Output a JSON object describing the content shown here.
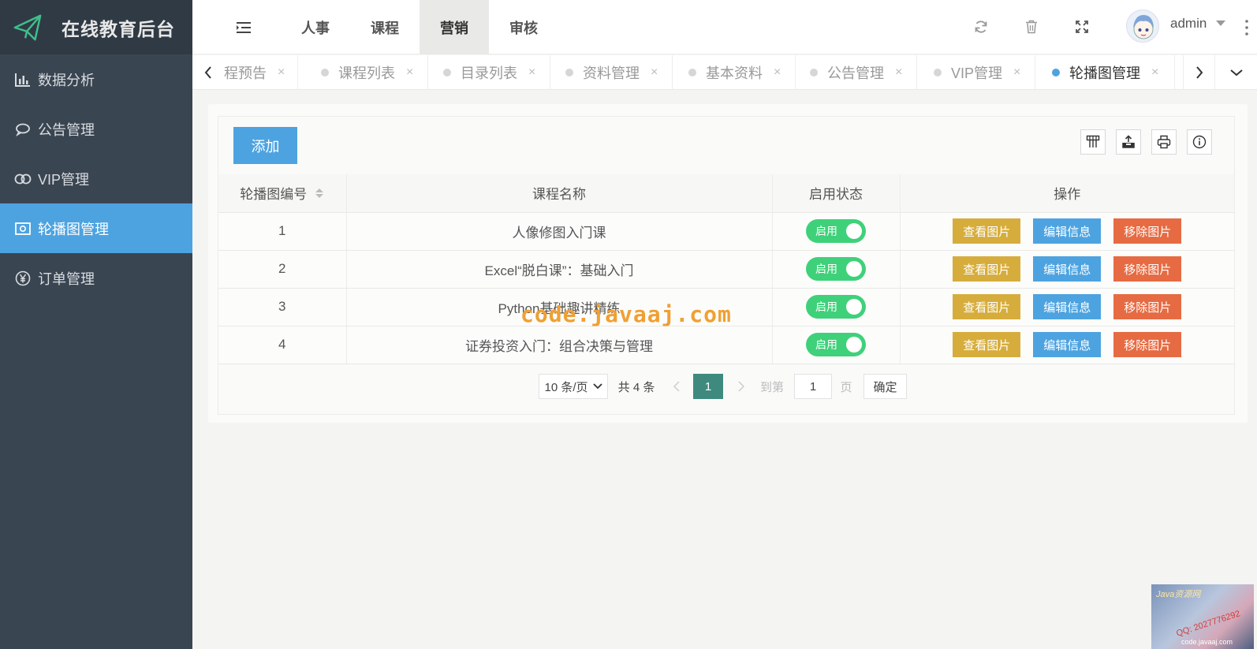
{
  "brand": {
    "title": "在线教育后台"
  },
  "sidebar": {
    "items": [
      {
        "label": "数据分析",
        "icon": "bar-chart-icon",
        "active": false
      },
      {
        "label": "公告管理",
        "icon": "chat-bubble-icon",
        "active": false
      },
      {
        "label": "VIP管理",
        "icon": "vip-icon",
        "active": false
      },
      {
        "label": "轮播图管理",
        "icon": "image-frame-icon",
        "active": true
      },
      {
        "label": "订单管理",
        "icon": "yen-icon",
        "active": false
      }
    ]
  },
  "topnav": {
    "tabs": [
      {
        "label": "人事"
      },
      {
        "label": "课程"
      },
      {
        "label": "营销",
        "active": true
      },
      {
        "label": "审核"
      }
    ],
    "user": "admin"
  },
  "pagetabs": [
    {
      "label": "程预告",
      "close": "×"
    },
    {
      "label": "课程列表",
      "close": "×"
    },
    {
      "label": "目录列表",
      "close": "×"
    },
    {
      "label": "资料管理",
      "close": "×"
    },
    {
      "label": "基本资料",
      "close": "×"
    },
    {
      "label": "公告管理",
      "close": "×"
    },
    {
      "label": "VIP管理",
      "close": "×"
    },
    {
      "label": "轮播图管理",
      "close": "×",
      "active": true
    }
  ],
  "toolbar": {
    "add_label": "添加"
  },
  "table": {
    "headers": [
      "轮播图编号",
      "课程名称",
      "启用状态",
      "操作"
    ],
    "rows": [
      {
        "id": "1",
        "name": "人像修图入门课",
        "status": "启用"
      },
      {
        "id": "2",
        "name": "Excel“脱白课”：基础入门",
        "status": "启用"
      },
      {
        "id": "3",
        "name": "Python基础趣讲精练",
        "status": "启用"
      },
      {
        "id": "4",
        "name": "证券投资入门：组合决策与管理",
        "status": "启用"
      }
    ],
    "actions": {
      "view": "查看图片",
      "edit": "编辑信息",
      "remove": "移除图片"
    }
  },
  "pager": {
    "page_size": "10 条/页",
    "total": "共 4 条",
    "current": "1",
    "goto_label": "到第",
    "goto_value": "1",
    "page_unit": "页",
    "confirm": "确定"
  },
  "watermark": "code.javaaj.com",
  "corner_ad": {
    "title": "Java资源网",
    "qq": "QQ: 2027776292",
    "site": "code.javaaj.com"
  },
  "colors": {
    "accent": "#4da3e0",
    "sidebar": "#3a4552",
    "switch_on": "#3fd17a",
    "view": "#d6ad3c",
    "remove": "#e66b43",
    "pager_current": "#3f8a7f"
  }
}
